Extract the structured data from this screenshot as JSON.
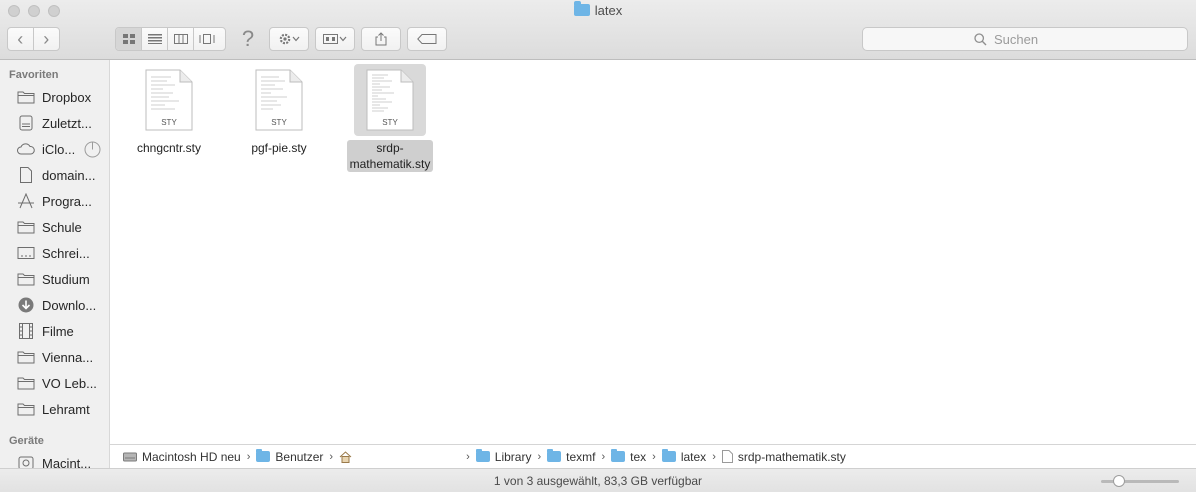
{
  "window": {
    "title": "latex"
  },
  "toolbar": {
    "back_label": "‹",
    "forward_label": "›",
    "help_label": "?",
    "search_placeholder": "Suchen"
  },
  "sidebar": {
    "favorites_heading": "Favoriten",
    "devices_heading": "Geräte",
    "items": [
      {
        "label": "Dropbox",
        "icon": "folder-icon"
      },
      {
        "label": "Zuletzt...",
        "icon": "recents-icon"
      },
      {
        "label": "iClo...",
        "icon": "cloud-icon"
      },
      {
        "label": "domain...",
        "icon": "document-icon"
      },
      {
        "label": "Progra...",
        "icon": "applications-icon"
      },
      {
        "label": "Schule",
        "icon": "folder-icon"
      },
      {
        "label": "Schrei...",
        "icon": "desktop-icon"
      },
      {
        "label": "Studium",
        "icon": "folder-icon"
      },
      {
        "label": "Downlo...",
        "icon": "download-icon"
      },
      {
        "label": "Filme",
        "icon": "film-icon"
      },
      {
        "label": "Vienna...",
        "icon": "folder-icon"
      },
      {
        "label": "VO Leb...",
        "icon": "folder-icon"
      },
      {
        "label": "Lehramt",
        "icon": "folder-icon"
      }
    ],
    "devices": [
      {
        "label": "Macint...",
        "icon": "harddisk-icon"
      }
    ]
  },
  "files": [
    {
      "name": "chngcntr.sty",
      "ext": "STY",
      "selected": false
    },
    {
      "name": "pgf-pie.sty",
      "ext": "STY",
      "selected": false
    },
    {
      "name_line1": "srdp-",
      "name_line2": "mathematik.sty",
      "ext": "STY",
      "selected": true
    }
  ],
  "pathbar": {
    "items": [
      "Macintosh HD neu",
      "Benutzer",
      "Library",
      "texmf",
      "tex",
      "latex",
      "srdp-mathematik.sty"
    ]
  },
  "status": {
    "text": "1 von 3 ausgewählt, 83,3 GB verfügbar"
  },
  "zoom": {
    "level": 0.18
  }
}
